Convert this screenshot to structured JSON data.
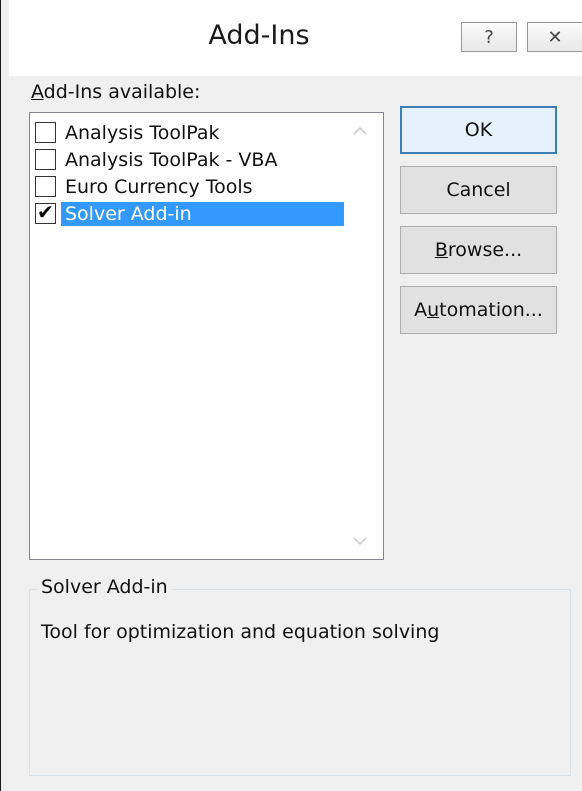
{
  "dialog": {
    "title": "Add-Ins",
    "help_glyph": "?",
    "close_glyph": "✕"
  },
  "list": {
    "label_prefix": "A",
    "label_rest": "dd-Ins available:",
    "items": [
      {
        "label": "Analysis ToolPak",
        "checked": false,
        "selected": false
      },
      {
        "label": "Analysis ToolPak - VBA",
        "checked": false,
        "selected": false
      },
      {
        "label": "Euro Currency Tools",
        "checked": false,
        "selected": false
      },
      {
        "label": "Solver Add-in",
        "checked": true,
        "selected": true
      }
    ],
    "check_glyph": "✔"
  },
  "buttons": {
    "ok": "OK",
    "cancel": "Cancel",
    "browse_prefix": "B",
    "browse_rest": "rowse...",
    "automation_prefix": "A",
    "automation_u": "u",
    "automation_rest": "tomation..."
  },
  "details": {
    "title": "Solver Add-in",
    "description": "Tool for optimization and equation solving"
  },
  "colors": {
    "selection": "#3399ff",
    "client_bg": "#f0f0f0",
    "default_button_border": "#3c7fb1"
  }
}
